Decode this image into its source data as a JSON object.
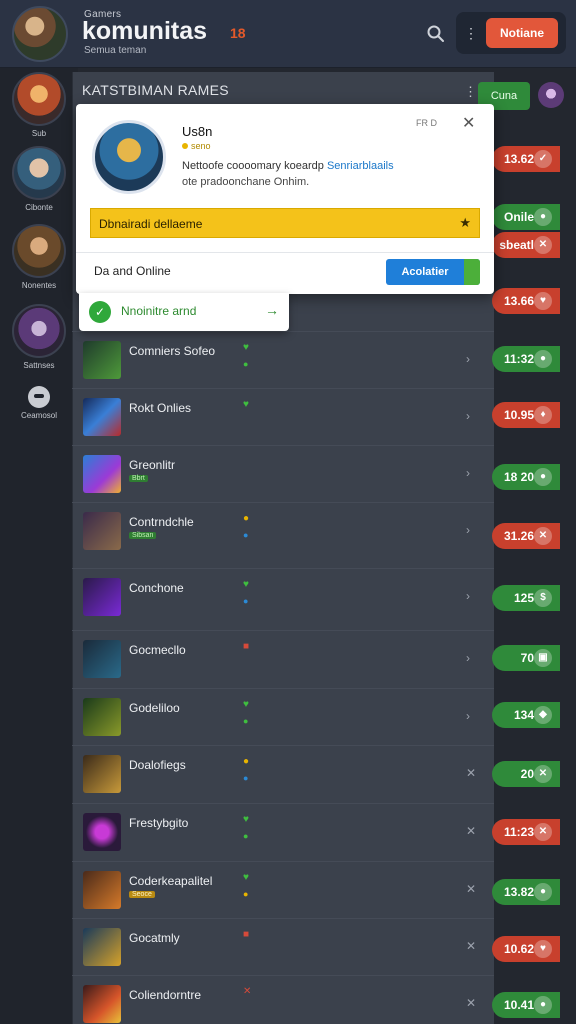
{
  "header": {
    "subtitle": "Gamers",
    "title": "komunitas",
    "title_badge": "18",
    "caption": "Semua teman",
    "action_label": "Notiane"
  },
  "rail": {
    "items": [
      {
        "label": "Sub"
      },
      {
        "label": "Cibonte"
      },
      {
        "label": "Nonentes"
      },
      {
        "label": "Sattnses"
      },
      {
        "label": "Ceamosol"
      }
    ]
  },
  "panel": {
    "title": "KATSTBIMAN RAMES",
    "side_button": "Cuna"
  },
  "popup": {
    "user": "Us8n",
    "status": "seno",
    "desc_part1": "Nettoofe coooomary koeardp",
    "desc_highlight": "Senriarblaails",
    "desc2": "ote pradoonchane Onhim.",
    "meta": "FR  D",
    "banner": "Dbnairadi dellaeme",
    "online_label": "Da and Online",
    "button": "Acolatier"
  },
  "toast": {
    "text": "Nnoinitre arnd"
  },
  "rows": [
    {
      "title": "Comniers Sofeo",
      "tag": "",
      "value": "11:32"
    },
    {
      "title": "Rokt Onlies",
      "tag": "",
      "value": "10.95"
    },
    {
      "title": "Greonlitr",
      "tag": "Bbrt",
      "value": "18 20"
    },
    {
      "title": "Contrndchle",
      "tag": "Sibsan",
      "value": "31.26"
    },
    {
      "title": "Conchone",
      "tag": "",
      "value": "125"
    },
    {
      "title": "Gocmecllo",
      "tag": "",
      "value": "70"
    },
    {
      "title": "Godeliloo",
      "tag": "",
      "value": "134"
    },
    {
      "title": "Doalofiegs",
      "tag": "",
      "value": "20"
    },
    {
      "title": "Frestybgito",
      "tag": "",
      "value": "11:23"
    },
    {
      "title": "Coderkeapalitel",
      "tag": "Seoce",
      "value": "13.82"
    },
    {
      "title": "Gocatmly",
      "tag": "",
      "value": "10.62"
    },
    {
      "title": "Coliendorntre",
      "tag": "",
      "value": "10.41"
    }
  ],
  "pill_extra": [
    {
      "value": "13.62"
    },
    {
      "value": "Onile"
    },
    {
      "value": "sbeatl"
    },
    {
      "value": "13.66"
    }
  ]
}
